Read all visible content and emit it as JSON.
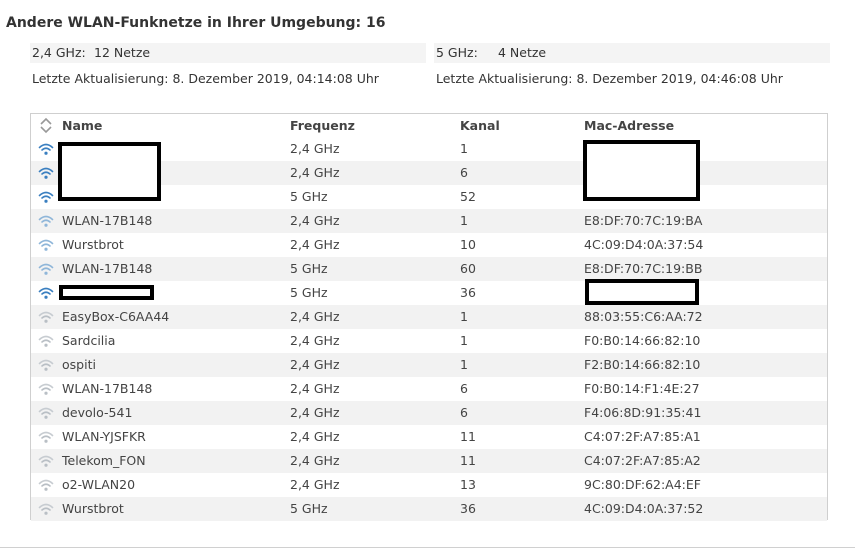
{
  "title": "Andere WLAN-Funknetze in Ihrer Umgebung: 16",
  "summary": {
    "ghz24": {
      "label": "2,4 GHz:",
      "count": "12 Netze",
      "updated": "Letzte Aktualisierung: 8. Dezember 2019, 04:14:08 Uhr"
    },
    "ghz5": {
      "label": "5 GHz:",
      "count": "4 Netze",
      "updated": "Letzte Aktualisierung: 8. Dezember 2019, 04:46:08 Uhr"
    }
  },
  "table": {
    "headers": {
      "name": "Name",
      "freq": "Frequenz",
      "chan": "Kanal",
      "mac": "Mac-Adresse"
    },
    "rows": [
      {
        "name": "",
        "freq": "2,4 GHz",
        "chan": "1",
        "mac": "",
        "signal": "strong"
      },
      {
        "name": "",
        "freq": "2,4 GHz",
        "chan": "6",
        "mac": "",
        "signal": "strong"
      },
      {
        "name": "",
        "freq": "5 GHz",
        "chan": "52",
        "mac": "",
        "signal": "strong"
      },
      {
        "name": "WLAN-17B148",
        "freq": "2,4 GHz",
        "chan": "1",
        "mac": "E8:DF:70:7C:19:BA",
        "signal": "medium"
      },
      {
        "name": "Wurstbrot",
        "freq": "2,4 GHz",
        "chan": "10",
        "mac": "4C:09:D4:0A:37:54",
        "signal": "medium"
      },
      {
        "name": "WLAN-17B148",
        "freq": "5 GHz",
        "chan": "60",
        "mac": "E8:DF:70:7C:19:BB",
        "signal": "medium"
      },
      {
        "name": "",
        "freq": "5 GHz",
        "chan": "36",
        "mac": "",
        "signal": "strong"
      },
      {
        "name": "EasyBox-C6AA44",
        "freq": "2,4 GHz",
        "chan": "1",
        "mac": "88:03:55:C6:AA:72",
        "signal": "weak"
      },
      {
        "name": "Sardcilia",
        "freq": "2,4 GHz",
        "chan": "1",
        "mac": "F0:B0:14:66:82:10",
        "signal": "weak"
      },
      {
        "name": "ospiti",
        "freq": "2,4 GHz",
        "chan": "1",
        "mac": "F2:B0:14:66:82:10",
        "signal": "weak"
      },
      {
        "name": "WLAN-17B148",
        "freq": "2,4 GHz",
        "chan": "6",
        "mac": "F0:B0:14:F1:4E:27",
        "signal": "weak"
      },
      {
        "name": "devolo-541",
        "freq": "2,4 GHz",
        "chan": "6",
        "mac": "F4:06:8D:91:35:41",
        "signal": "weak"
      },
      {
        "name": "WLAN-YJSFKR",
        "freq": "2,4 GHz",
        "chan": "11",
        "mac": "C4:07:2F:A7:85:A1",
        "signal": "weak"
      },
      {
        "name": "Telekom_FON",
        "freq": "2,4 GHz",
        "chan": "11",
        "mac": "C4:07:2F:A7:85:A2",
        "signal": "weak"
      },
      {
        "name": "o2-WLAN20",
        "freq": "2,4 GHz",
        "chan": "13",
        "mac": "9C:80:DF:62:A4:EF",
        "signal": "weak"
      },
      {
        "name": "Wurstbrot",
        "freq": "5 GHz",
        "chan": "36",
        "mac": "4C:09:D4:0A:37:52",
        "signal": "weak"
      }
    ]
  },
  "colors": {
    "wifi_strong": "#3a7fc0",
    "wifi_medium": "#8fb6d9",
    "wifi_weak": "#b9bfc5",
    "row_alt": "#f2f2f2"
  }
}
